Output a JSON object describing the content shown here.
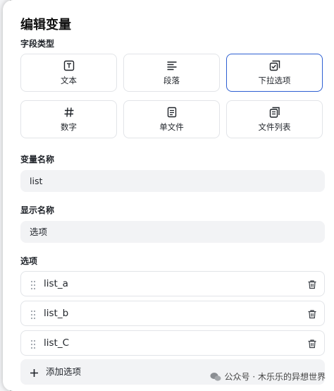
{
  "dialog": {
    "title": "编辑变量",
    "field_type_label": "字段类型",
    "field_types": [
      {
        "label": "文本",
        "icon": "text-box-icon",
        "selected": false
      },
      {
        "label": "段落",
        "icon": "paragraph-icon",
        "selected": false
      },
      {
        "label": "下拉选项",
        "icon": "dropdown-check-icon",
        "selected": true
      },
      {
        "label": "数字",
        "icon": "hash-icon",
        "selected": false
      },
      {
        "label": "单文件",
        "icon": "file-icon",
        "selected": false
      },
      {
        "label": "文件列表",
        "icon": "file-list-icon",
        "selected": false
      }
    ],
    "variable_name_label": "变量名称",
    "variable_name_value": "list",
    "display_name_label": "显示名称",
    "display_name_value": "选项",
    "options_label": "选项",
    "options": [
      {
        "value": "list_a"
      },
      {
        "value": "list_b"
      },
      {
        "value": "list_C"
      }
    ],
    "add_option_label": "添加选项"
  },
  "watermark": "公众号 · 木乐乐的异想世界",
  "colors": {
    "selected_border": "#2d5fd2",
    "input_bg": "#f2f3f5",
    "border": "#e2e4e8"
  }
}
